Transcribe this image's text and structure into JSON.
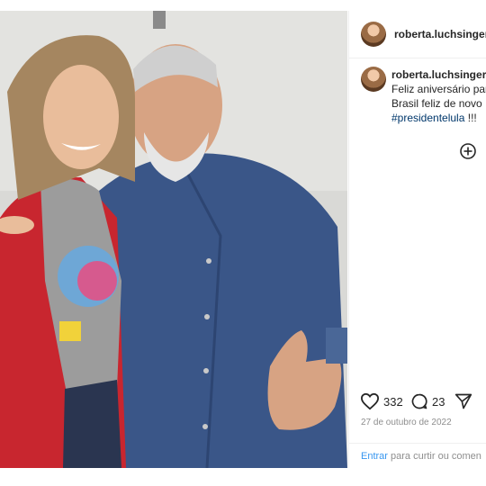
{
  "post": {
    "username": "roberta.luchsinger",
    "photo_alt_icon": "post-photo"
  },
  "caption": {
    "username": "roberta.luchsinger",
    "line1": "Feliz aniversário para",
    "line2": "Brasil feliz de novo !",
    "hashtag": "#presidentelula",
    "hashtag_suffix": " !!!"
  },
  "actions": {
    "like_icon": "heart-icon",
    "likes": "332",
    "comment_icon": "comment-icon",
    "comments": "23",
    "share_icon": "send-icon",
    "more_icon": "plus-circle-icon"
  },
  "date": "27 de outubro de 2022",
  "login": {
    "link": "Entrar",
    "text": " para curtir ou comen"
  },
  "colors": {
    "link": "#3897f0",
    "hashtag": "#00376b",
    "muted": "#8e8e8e",
    "text": "#262626"
  }
}
